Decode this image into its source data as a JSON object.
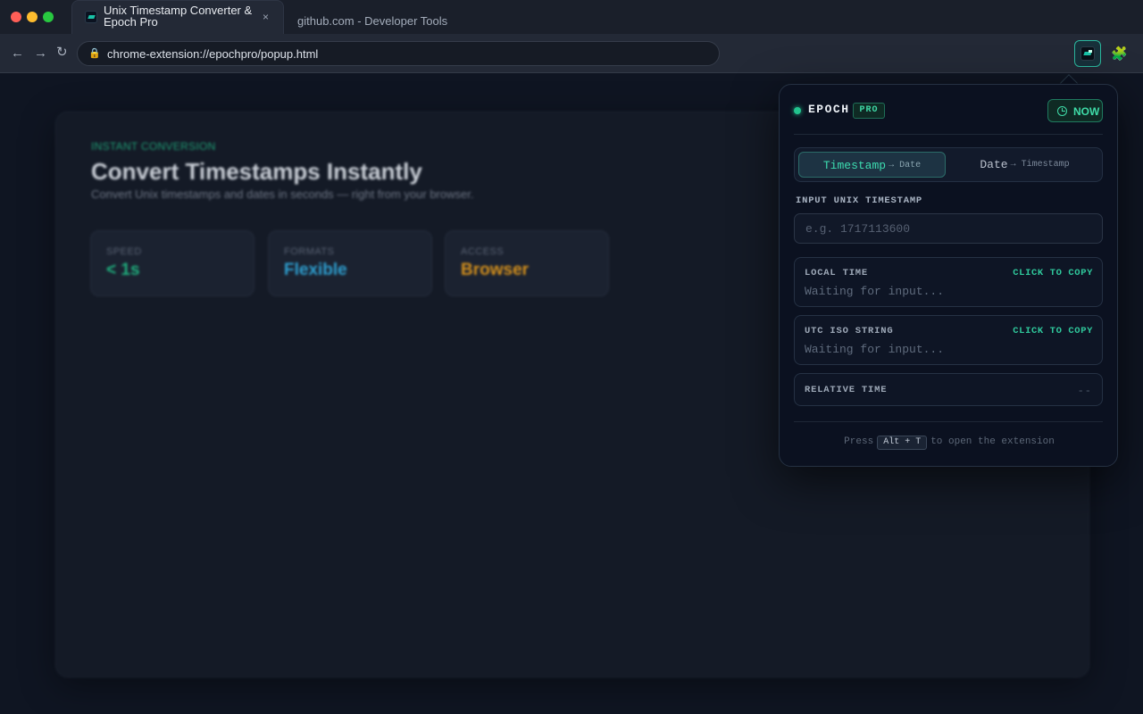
{
  "browser": {
    "active_tab": {
      "title": "Unix Timestamp Converter & Epoch Pro",
      "close_glyph": "×"
    },
    "inactive_tab": {
      "title": "github.com - Developer Tools"
    },
    "nav": {
      "back": "←",
      "forward": "→",
      "reload": "↻"
    },
    "url": "chrome-extension://epochpro/popup.html",
    "extension_icon": "epoch-pro-icon",
    "extensions_menu_icon": "puzzle-icon"
  },
  "page": {
    "eyebrow": "INSTANT CONVERSION",
    "title": "Convert Timestamps Instantly",
    "subtitle": "Convert Unix timestamps and dates in seconds — right from your browser.",
    "stats": [
      {
        "label": "SPEED",
        "value": "< 1s",
        "color": "#1fb07e"
      },
      {
        "label": "FORMATS",
        "value": "Flexible",
        "color": "#2e9fd0"
      },
      {
        "label": "ACCESS",
        "value": "Browser",
        "color": "#d4901c"
      }
    ]
  },
  "popup": {
    "brand": "EPOCH",
    "badge": "PRO",
    "now_button": "NOW",
    "modes": [
      {
        "main": "Timestamp",
        "sub": "→ Date",
        "active": true
      },
      {
        "main": "Date",
        "sub": "→ Timestamp",
        "active": false
      }
    ],
    "input_label": "INPUT UNIX TIMESTAMP",
    "input_placeholder": "e.g. 1717113600",
    "input_value": "",
    "outputs": {
      "local": {
        "title": "LOCAL TIME",
        "copy": "CLICK TO COPY",
        "value": "Waiting for input..."
      },
      "utc": {
        "title": "UTC ISO STRING",
        "copy": "CLICK TO COPY",
        "value": "Waiting for input..."
      },
      "relative": {
        "title": "RELATIVE TIME",
        "value": "--"
      }
    },
    "footer": {
      "before": "Press",
      "shortcut": "Alt + T",
      "after": "to open the extension"
    },
    "accent": "#22c38e"
  }
}
